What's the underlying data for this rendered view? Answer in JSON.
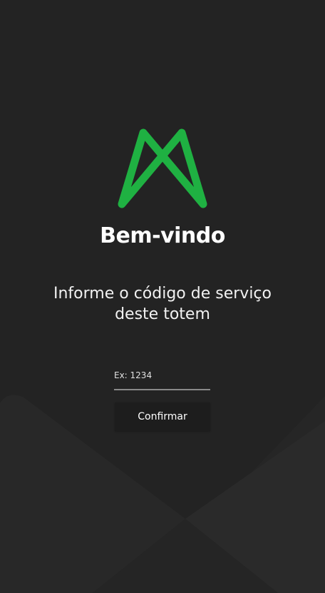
{
  "welcome": {
    "title": "Bem-vindo",
    "prompt_line1": "Informe o código de serviço",
    "prompt_line2": "deste totem"
  },
  "form": {
    "code_placeholder": "Ex: 1234",
    "code_value": "",
    "confirm_label": "Confirmar"
  },
  "colors": {
    "background": "#232323",
    "brand_green": "#1fb142",
    "button_bg": "#1d1d1d"
  }
}
